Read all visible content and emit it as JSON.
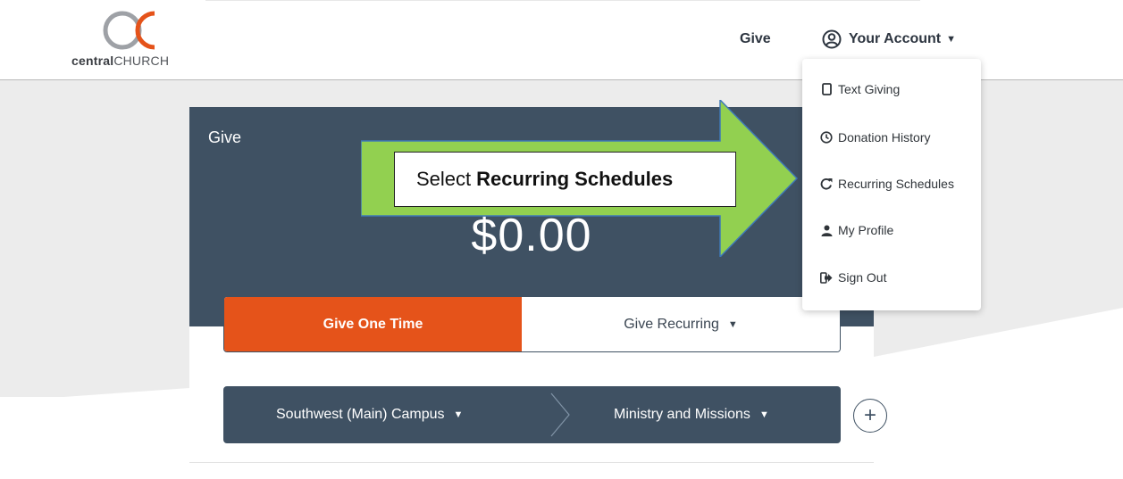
{
  "header": {
    "logo": {
      "bold": "central",
      "light": "CHURCH"
    },
    "nav_give": "Give",
    "nav_account": "Your Account"
  },
  "dropdown": {
    "items": [
      {
        "label": "Text Giving",
        "icon": "phone-icon"
      },
      {
        "label": "Donation History",
        "icon": "clock-icon"
      },
      {
        "label": "Recurring Schedules",
        "icon": "redo-icon"
      },
      {
        "label": "My Profile",
        "icon": "user-icon"
      },
      {
        "label": "Sign Out",
        "icon": "sign-out-icon"
      }
    ]
  },
  "card": {
    "title": "Give",
    "amount": "$0.00",
    "give_one_time": "Give One Time",
    "give_recurring": "Give Recurring",
    "campus": "Southwest (Main) Campus",
    "fund": "Ministry and Missions",
    "add_symbol": "+"
  },
  "annotation": {
    "prefix": "Select",
    "emphasis": "Recurring Schedules"
  },
  "colors": {
    "brand_orange": "#e5531a",
    "slate": "#3f5163",
    "arrow_green": "#92d050"
  }
}
